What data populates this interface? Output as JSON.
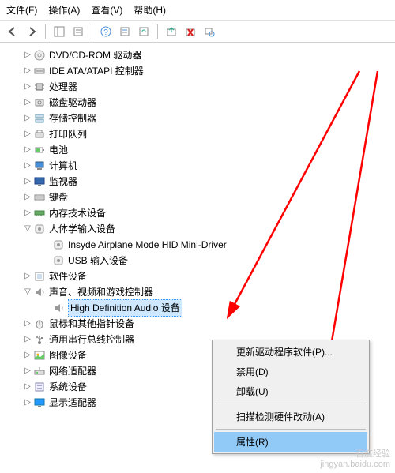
{
  "menubar": {
    "file": "文件(F)",
    "action": "操作(A)",
    "view": "查看(V)",
    "help": "帮助(H)"
  },
  "tree": {
    "items": [
      {
        "label": "DVD/CD-ROM 驱动器",
        "icon": "disc",
        "depth": 1,
        "expander": "▷"
      },
      {
        "label": "IDE ATA/ATAPI 控制器",
        "icon": "ide",
        "depth": 1,
        "expander": "▷"
      },
      {
        "label": "处理器",
        "icon": "cpu",
        "depth": 1,
        "expander": "▷"
      },
      {
        "label": "磁盘驱动器",
        "icon": "disk",
        "depth": 1,
        "expander": "▷"
      },
      {
        "label": "存储控制器",
        "icon": "storage",
        "depth": 1,
        "expander": "▷"
      },
      {
        "label": "打印队列",
        "icon": "printer",
        "depth": 1,
        "expander": "▷"
      },
      {
        "label": "电池",
        "icon": "battery",
        "depth": 1,
        "expander": "▷"
      },
      {
        "label": "计算机",
        "icon": "computer",
        "depth": 1,
        "expander": "▷"
      },
      {
        "label": "监视器",
        "icon": "monitor",
        "depth": 1,
        "expander": "▷"
      },
      {
        "label": "键盘",
        "icon": "keyboard",
        "depth": 1,
        "expander": "▷"
      },
      {
        "label": "内存技术设备",
        "icon": "memory",
        "depth": 1,
        "expander": "▷"
      },
      {
        "label": "人体学输入设备",
        "icon": "hid",
        "depth": 1,
        "expander": "▽"
      },
      {
        "label": "Insyde Airplane Mode HID Mini-Driver",
        "icon": "hid",
        "depth": 2,
        "expander": ""
      },
      {
        "label": "USB 输入设备",
        "icon": "hid",
        "depth": 2,
        "expander": ""
      },
      {
        "label": "软件设备",
        "icon": "software",
        "depth": 1,
        "expander": "▷"
      },
      {
        "label": "声音、视频和游戏控制器",
        "icon": "audio",
        "depth": 1,
        "expander": "▽"
      },
      {
        "label": "High Definition Audio 设备",
        "icon": "audio",
        "depth": 2,
        "expander": "",
        "selected": true
      },
      {
        "label": "鼠标和其他指针设备",
        "icon": "mouse",
        "depth": 1,
        "expander": "▷"
      },
      {
        "label": "通用串行总线控制器",
        "icon": "usb",
        "depth": 1,
        "expander": "▷"
      },
      {
        "label": "图像设备",
        "icon": "image",
        "depth": 1,
        "expander": "▷"
      },
      {
        "label": "网络适配器",
        "icon": "network",
        "depth": 1,
        "expander": "▷"
      },
      {
        "label": "系统设备",
        "icon": "system",
        "depth": 1,
        "expander": "▷"
      },
      {
        "label": "显示适配器",
        "icon": "display",
        "depth": 1,
        "expander": "▷"
      }
    ]
  },
  "context_menu": {
    "update_driver": "更新驱动程序软件(P)...",
    "disable": "禁用(D)",
    "uninstall": "卸载(U)",
    "scan_hardware": "扫描检测硬件改动(A)",
    "properties": "属性(R)"
  },
  "watermark": {
    "line1": "百度经验",
    "line2": "jingyan.baidu.com"
  },
  "colors": {
    "arrow": "#ff0000",
    "selection": "#cde8ff",
    "menu_highlight": "#91c9f7"
  }
}
